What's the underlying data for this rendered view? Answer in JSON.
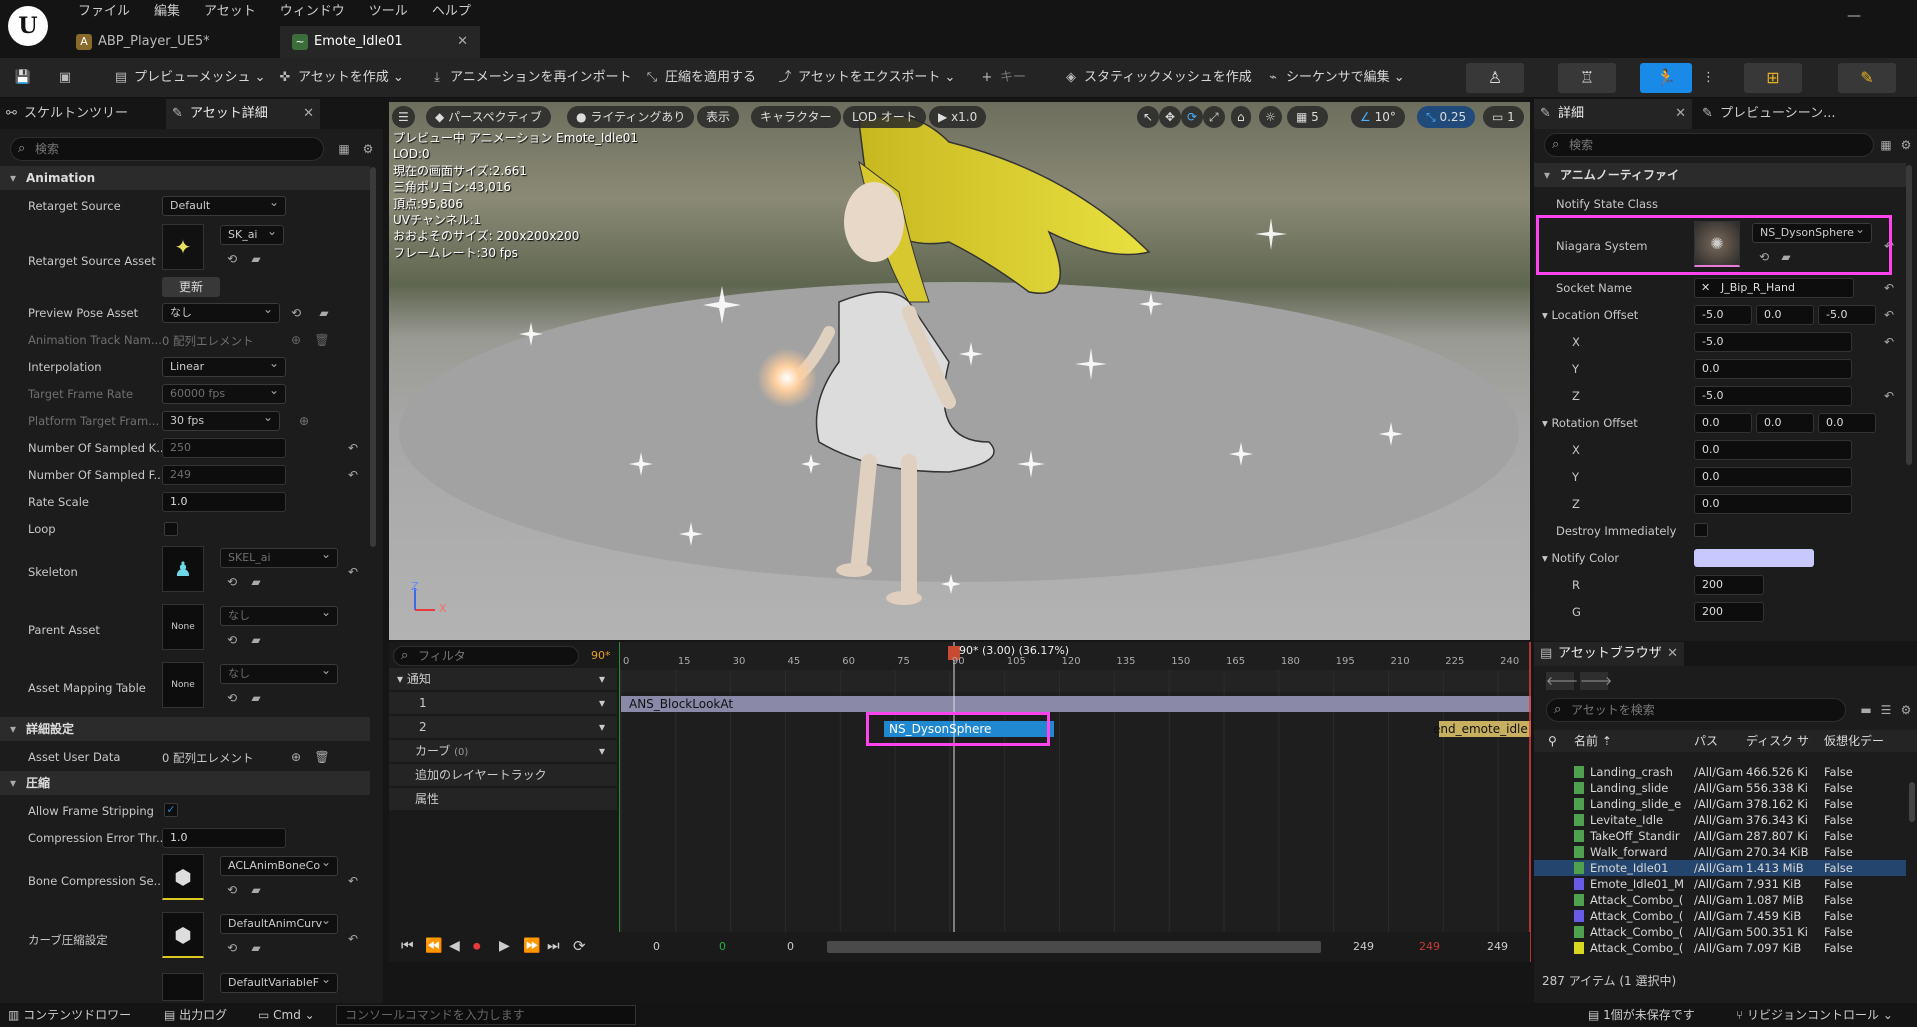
{
  "menu": [
    "ファイル",
    "編集",
    "アセット",
    "ウィンドウ",
    "ツール",
    "ヘルプ"
  ],
  "tabs": [
    {
      "label": "ABP_Player_UE5*"
    },
    {
      "label": "Emote_Idle01"
    }
  ],
  "toolbar": {
    "preview_mesh": "プレビューメッシュ",
    "create_asset": "アセットを作成",
    "reimport": "アニメーションを再インポート",
    "apply_compression": "圧縮を適用する",
    "export_asset": "アセットをエクスポート",
    "key": "キー",
    "make_static_mesh": "スタティックメッシュを作成",
    "edit_in_sequencer": "シーケンサで編集"
  },
  "left": {
    "tab_skeleton": "スケルトンツリー",
    "tab_details": "アセット詳細",
    "search_placeholder": "検索",
    "sec_animation": "Animation",
    "retarget_source": "Retarget Source",
    "retarget_source_val": "Default",
    "retarget_source_asset": "Retarget Source Asset",
    "retarget_source_asset_val": "SK_ai",
    "update_btn": "更新",
    "preview_pose_asset": "Preview Pose Asset",
    "preview_pose_asset_val": "なし",
    "anim_track_names": "Animation Track Nam...",
    "anim_track_names_val": "0 配列エレメント",
    "interpolation": "Interpolation",
    "interpolation_val": "Linear",
    "target_frame_rate": "Target Frame Rate",
    "target_frame_rate_val": "60000 fps",
    "platform_target": "Platform Target Fram...",
    "platform_target_val": "30 fps",
    "num_sampled_keys": "Number Of Sampled K...",
    "num_sampled_keys_val": "250",
    "num_sampled_frames": "Number Of Sampled F...",
    "num_sampled_frames_val": "249",
    "rate_scale": "Rate Scale",
    "rate_scale_val": "1.0",
    "loop": "Loop",
    "skeleton": "Skeleton",
    "skeleton_val": "SKEL_ai",
    "parent_asset": "Parent Asset",
    "parent_asset_val": "なし",
    "none_thumb": "None",
    "asset_mapping": "Asset Mapping Table",
    "asset_mapping_val": "なし",
    "sec_detail": "詳細設定",
    "asset_user_data": "Asset User Data",
    "asset_user_data_val": "0 配列エレメント",
    "sec_compression": "圧縮",
    "allow_frame_stripping": "Allow Frame Stripping",
    "compression_error": "Compression Error Thr...",
    "compression_error_val": "1.0",
    "bone_compression": "Bone Compression Se...",
    "bone_compression_val": "ACLAnimBoneCo",
    "curve_compression": "カーブ圧縮設定",
    "curve_compression_val": "DefaultAnimCurv",
    "variable_val": "DefaultVariableF"
  },
  "viewport": {
    "menu_icon": "hamburger-icon",
    "perspective": "パースペクティブ",
    "lighting": "ライティングあり",
    "show": "表示",
    "character": "キャラクター",
    "lod": "LOD オート",
    "speed": "x1.0",
    "grid_num": "5",
    "angle": "10°",
    "scale": "0.25",
    "cam": "1",
    "info": [
      "プレビュー中 アニメーション Emote_Idle01",
      "LOD:0",
      "現在の画面サイズ:2.661",
      "三角ポリゴン:43,016",
      "頂点:95,806",
      "UVチャンネル:1",
      "おおよそのサイズ: 200x200x200",
      "フレームレート:30 fps"
    ],
    "axis_z": "Z",
    "axis_x": "X"
  },
  "timeline": {
    "filter_placeholder": "フィルタ",
    "frame_badge": "90*",
    "playhead_label": "90* (3.00) (36.17%)",
    "tracks": [
      {
        "label": "通知"
      },
      {
        "label": "1"
      },
      {
        "label": "2"
      },
      {
        "label": "カーブ"
      },
      {
        "label": "追加のレイヤートラック"
      },
      {
        "label": "属性"
      }
    ],
    "curve_count": "(0)",
    "ticks": [
      "0",
      "15",
      "30",
      "45",
      "60",
      "75",
      "90",
      "105",
      "120",
      "135",
      "150",
      "165",
      "180",
      "195",
      "210",
      "225",
      "240"
    ],
    "notify_lookat": "ANS_BlockLookAt",
    "notify_dyson": "NS_DysonSphere",
    "notify_end": "end_emote_idle",
    "start": "0",
    "start_green": "0",
    "cur": "0",
    "end": "249",
    "end_red": "249",
    "end2": "249"
  },
  "details": {
    "tab_details": "詳細",
    "tab_preview": "プレビューシーン...",
    "search_placeholder": "検索",
    "sec_anim_notify": "アニムノーティファイ",
    "notify_state_class": "Notify State Class",
    "niagara_system": "Niagara System",
    "niagara_val": "NS_DysonSphere",
    "socket_name": "Socket Name",
    "socket_val": "J_Bip_R_Hand",
    "location_offset": "Location Offset",
    "loc": [
      "-5.0",
      "0.0",
      "-5.0"
    ],
    "rotation_offset": "Rotation Offset",
    "rot": [
      "0.0",
      "0.0",
      "0.0"
    ],
    "x": "X",
    "y": "Y",
    "z": "Z",
    "destroy_immediately": "Destroy Immediately",
    "notify_color": "Notify Color",
    "notify_color_hex": "#c8c8ff",
    "r": "R",
    "r_val": "200",
    "g": "G",
    "g_val": "200"
  },
  "asset_browser": {
    "tab": "アセットブラウザ",
    "search_placeholder": "アセットを検索",
    "col_name": "名前",
    "col_path": "パス",
    "col_disk": "ディスク サ",
    "col_virtual": "仮想化デー",
    "rows": [
      {
        "name": "Landing_crash",
        "path": "/All/Gam",
        "size": "466.526 Ki",
        "virt": "False",
        "type": "anim"
      },
      {
        "name": "Landing_slide",
        "path": "/All/Gam",
        "size": "556.338 Ki",
        "virt": "False",
        "type": "anim"
      },
      {
        "name": "Landing_slide_e",
        "path": "/All/Gam",
        "size": "378.162 Ki",
        "virt": "False",
        "type": "anim"
      },
      {
        "name": "Levitate_Idle",
        "path": "/All/Gam",
        "size": "376.343 Ki",
        "virt": "False",
        "type": "anim"
      },
      {
        "name": "TakeOff_Standir",
        "path": "/All/Gam",
        "size": "287.807 Ki",
        "virt": "False",
        "type": "anim"
      },
      {
        "name": "Walk_forward",
        "path": "/All/Gam",
        "size": "270.34 KiB",
        "virt": "False",
        "type": "anim"
      },
      {
        "name": "Emote_Idle01",
        "path": "/All/Gam",
        "size": "1.413 MiB",
        "virt": "False",
        "type": "anim",
        "selected": true
      },
      {
        "name": "Emote_Idle01_M",
        "path": "/All/Gam",
        "size": "7.931 KiB",
        "virt": "False",
        "type": "montage"
      },
      {
        "name": "Attack_Combo_(",
        "path": "/All/Gam",
        "size": "1.087 MiB",
        "virt": "False",
        "type": "anim"
      },
      {
        "name": "Attack_Combo_(",
        "path": "/All/Gam",
        "size": "7.459 KiB",
        "virt": "False",
        "type": "montage"
      },
      {
        "name": "Attack_Combo_(",
        "path": "/All/Gam",
        "size": "500.351 Ki",
        "virt": "False",
        "type": "anim"
      },
      {
        "name": "Attack_Combo_(",
        "path": "/All/Gam",
        "size": "7.097 KiB",
        "virt": "False",
        "type": "blend"
      }
    ],
    "count": "287 アイテム (1 選択中)"
  },
  "status": {
    "content_drawer": "コンテンツドロワー",
    "output_log": "出力ログ",
    "cmd": "Cmd",
    "console_placeholder": "コンソールコマンドを入力します",
    "unsaved": "1個が未保存です",
    "revision": "リビジョンコントロール"
  },
  "colors": {
    "accent": "#1a8ae8",
    "highlight": "#ff44ee",
    "notify_bar": "#2088d0",
    "lookat_bar": "#8a8aa8",
    "end_notify": "#c8b060"
  }
}
